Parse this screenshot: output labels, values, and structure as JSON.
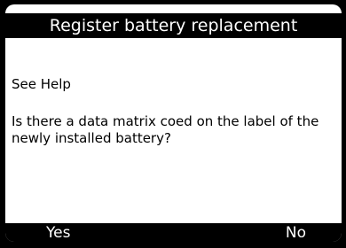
{
  "header": {
    "title": "Register battery replacement"
  },
  "content": {
    "help": "See Help",
    "question": "Is there a data matrix coed on the label of the newly installed battery?"
  },
  "buttons": {
    "yes_label": "Yes",
    "no_label": "No"
  },
  "colors": {
    "background": "#ffffff",
    "bars": "#000000",
    "bar_text": "#ffffff",
    "body_text": "#000000"
  }
}
